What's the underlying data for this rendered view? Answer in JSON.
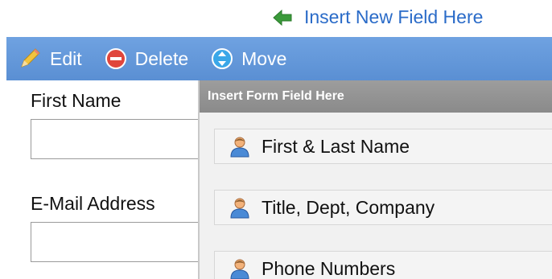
{
  "insert_link": {
    "label": "Insert New Field Here"
  },
  "toolbar": {
    "edit_label": "Edit",
    "delete_label": "Delete",
    "move_label": "Move"
  },
  "form": {
    "fields": [
      {
        "label": "First Name",
        "value": ""
      },
      {
        "label": "E-Mail Address",
        "value": ""
      }
    ]
  },
  "panel": {
    "title": "Insert Form Field Here",
    "items": [
      {
        "label": "First & Last Name",
        "icon": "person-icon"
      },
      {
        "label": "Title, Dept, Company",
        "icon": "person-icon"
      },
      {
        "label": "Phone Numbers",
        "icon": "person-icon"
      }
    ]
  },
  "colors": {
    "toolbar": "#5a8fd3",
    "link": "#2a6bc8",
    "panel_header": "#8f8f8f",
    "arrow_green": "#3a9a3a",
    "delete_red": "#e0463c",
    "move_blue": "#3aa7e8"
  }
}
